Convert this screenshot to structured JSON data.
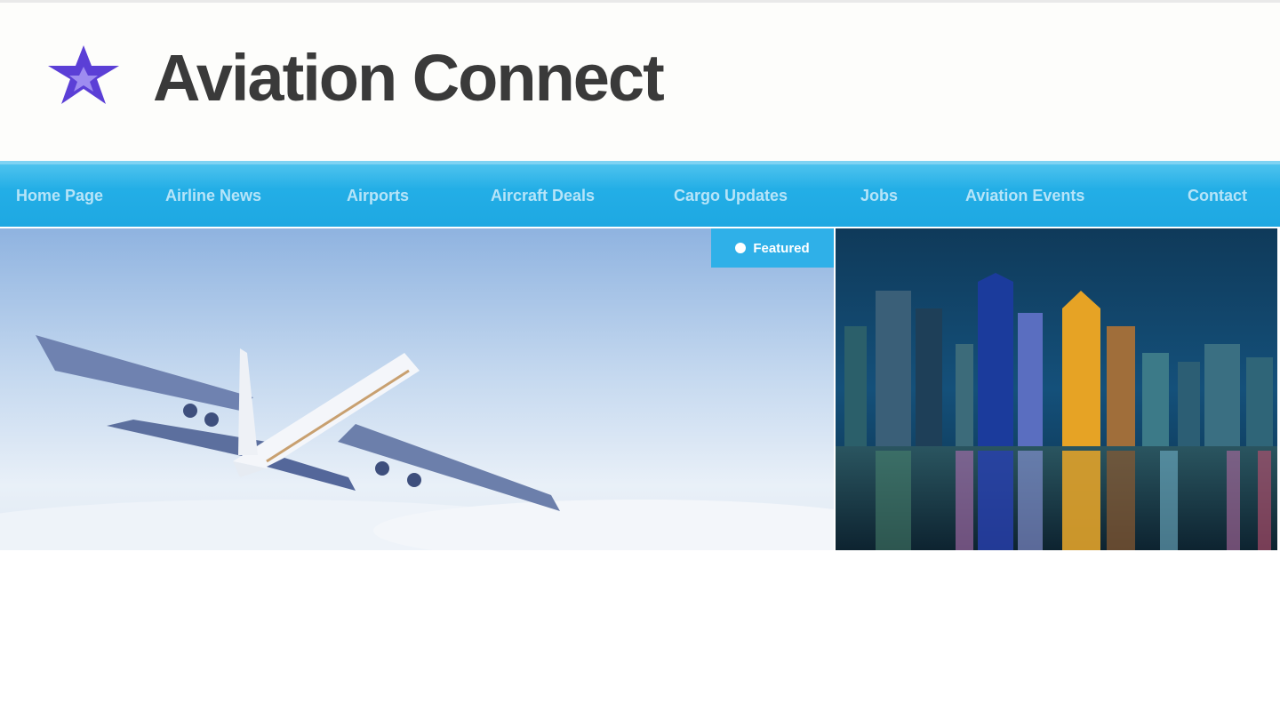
{
  "site": {
    "brand": "Aviation Connect",
    "logo_icon": "star-icon",
    "brand_color": "#5b3fd6"
  },
  "nav": {
    "color": "#22aee5",
    "items": [
      {
        "label": "Home Page"
      },
      {
        "label": "Airline News"
      },
      {
        "label": "Airports"
      },
      {
        "label": "Aircraft Deals"
      },
      {
        "label": "Cargo Updates"
      },
      {
        "label": "Jobs"
      },
      {
        "label": "Aviation Events"
      },
      {
        "label": "Contact"
      }
    ]
  },
  "featured": {
    "badge_label": "Featured",
    "badge_icon": "dot-icon",
    "main_image": "airplane-in-sky",
    "side_image": "city-skyline-at-night"
  }
}
